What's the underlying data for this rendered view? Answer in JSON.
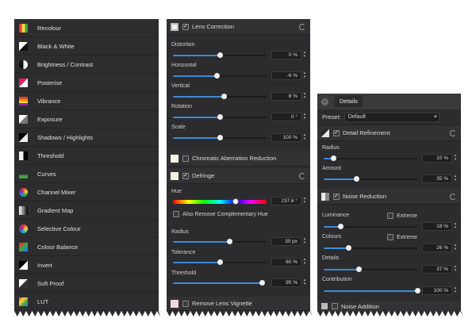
{
  "adjustments": [
    {
      "label": "Recolour",
      "icon": "recolour-icon"
    },
    {
      "label": "Black & White",
      "icon": "black-white-icon"
    },
    {
      "label": "Brightness / Contrast",
      "icon": "brightness-contrast-icon"
    },
    {
      "label": "Posterise",
      "icon": "posterise-icon"
    },
    {
      "label": "Vibrance",
      "icon": "vibrance-icon"
    },
    {
      "label": "Exposure",
      "icon": "exposure-icon"
    },
    {
      "label": "Shadows / Highlights",
      "icon": "shadows-highlights-icon"
    },
    {
      "label": "Threshold",
      "icon": "threshold-icon"
    },
    {
      "label": "Curves",
      "icon": "curves-icon"
    },
    {
      "label": "Channel Mixer",
      "icon": "channel-mixer-icon"
    },
    {
      "label": "Gradient Map",
      "icon": "gradient-map-icon"
    },
    {
      "label": "Selective Colour",
      "icon": "selective-colour-icon"
    },
    {
      "label": "Colour Balance",
      "icon": "colour-balance-icon"
    },
    {
      "label": "Invert",
      "icon": "invert-icon"
    },
    {
      "label": "Soft Proof",
      "icon": "soft-proof-icon"
    },
    {
      "label": "LUT",
      "icon": "lut-icon"
    }
  ],
  "lens": {
    "header": "Lens Correction",
    "sliders": [
      {
        "label": "Distortion",
        "value": "0 %",
        "position": 0.5
      },
      {
        "label": "Horizontal",
        "value": "-6 %",
        "position": 0.47
      },
      {
        "label": "Vertical",
        "value": "8 %",
        "position": 0.54
      },
      {
        "label": "Rotation",
        "value": "0 °",
        "position": 0.5
      },
      {
        "label": "Scale",
        "value": "100 %",
        "position": 0.5
      }
    ],
    "chromatic": "Chromatic Aberration Reduction",
    "defringe_header": "Defringe",
    "hue_label": "Hue",
    "hue_value": "237.6 °",
    "hue_position": 0.66,
    "complementary": "Also Remove Complementary Hue",
    "defringe_sliders": [
      {
        "label": "Radius",
        "value": "30 px",
        "position": 0.6
      },
      {
        "label": "Tolerance",
        "value": "60 %",
        "position": 0.5
      },
      {
        "label": "Threshold",
        "value": "95 %",
        "position": 0.95
      }
    ],
    "vignette": "Remove Lens Vignette"
  },
  "details": {
    "tab": "Details",
    "preset_label": "Preset:",
    "preset_value": "Default",
    "refinement_header": "Detail Refinement",
    "refinement_sliders": [
      {
        "label": "Radius",
        "value": "10 %",
        "position": 0.1
      },
      {
        "label": "Amount",
        "value": "35 %",
        "position": 0.35
      }
    ],
    "noise_header": "Noise Reduction",
    "noise_sliders": [
      {
        "label": "Luminance",
        "value": "18 %",
        "position": 0.18,
        "extreme": "Extreme"
      },
      {
        "label": "Colours",
        "value": "26 %",
        "position": 0.26,
        "extreme": "Extreme"
      },
      {
        "label": "Details",
        "value": "37 %",
        "position": 0.37
      },
      {
        "label": "Contribution",
        "value": "100 %",
        "position": 1.0
      }
    ],
    "noise_addition": "Noise Addition"
  },
  "colors": {
    "panel": "#2c2c2e",
    "accent": "#3d8bd8"
  }
}
